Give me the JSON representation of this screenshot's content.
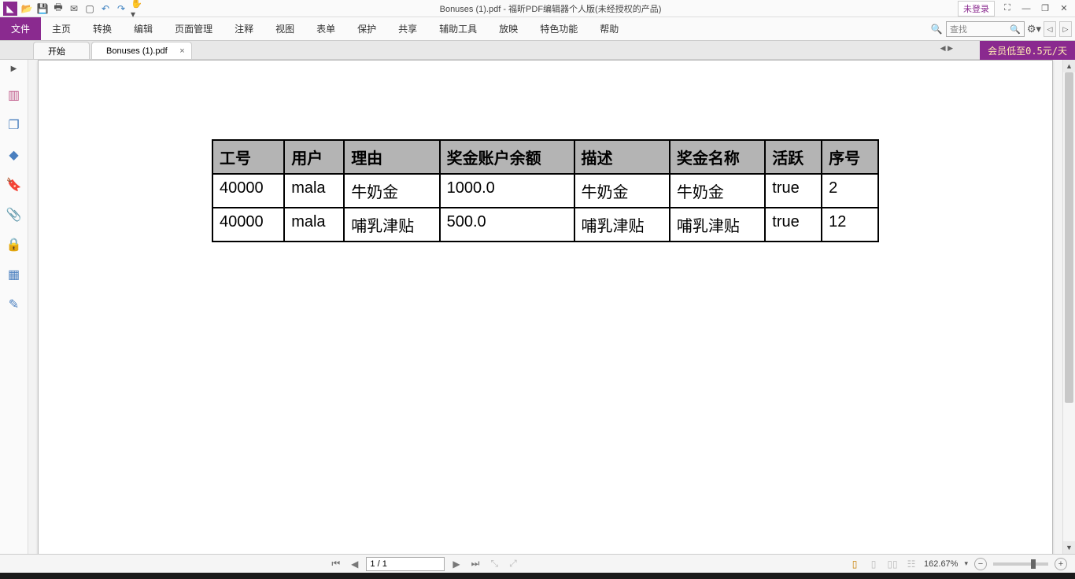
{
  "title": "Bonuses (1).pdf - 福昕PDF编辑器个人版(未经授权的产品)",
  "login": "未登录",
  "menu": {
    "file": "文件",
    "items": [
      "主页",
      "转换",
      "编辑",
      "页面管理",
      "注释",
      "视图",
      "表单",
      "保护",
      "共享",
      "辅助工具",
      "放映",
      "特色功能",
      "帮助"
    ]
  },
  "search_placeholder": "查找",
  "tabs": {
    "t0": "开始",
    "t1": "Bonuses (1).pdf"
  },
  "promo": "会员低至0.5元/天",
  "table": {
    "headers": [
      "工号",
      "用户",
      "理由",
      "奖金账户余额",
      "描述",
      "奖金名称",
      "活跃",
      "序号"
    ],
    "rows": [
      [
        "40000",
        "mala",
        "牛奶金",
        "1000.0",
        "牛奶金",
        "牛奶金",
        "true",
        "2"
      ],
      [
        "40000",
        "mala",
        "哺乳津贴",
        "500.0",
        "哺乳津贴",
        "哺乳津贴",
        "true",
        "12"
      ]
    ]
  },
  "status": {
    "page": "1 / 1",
    "zoom": "162.67%"
  }
}
